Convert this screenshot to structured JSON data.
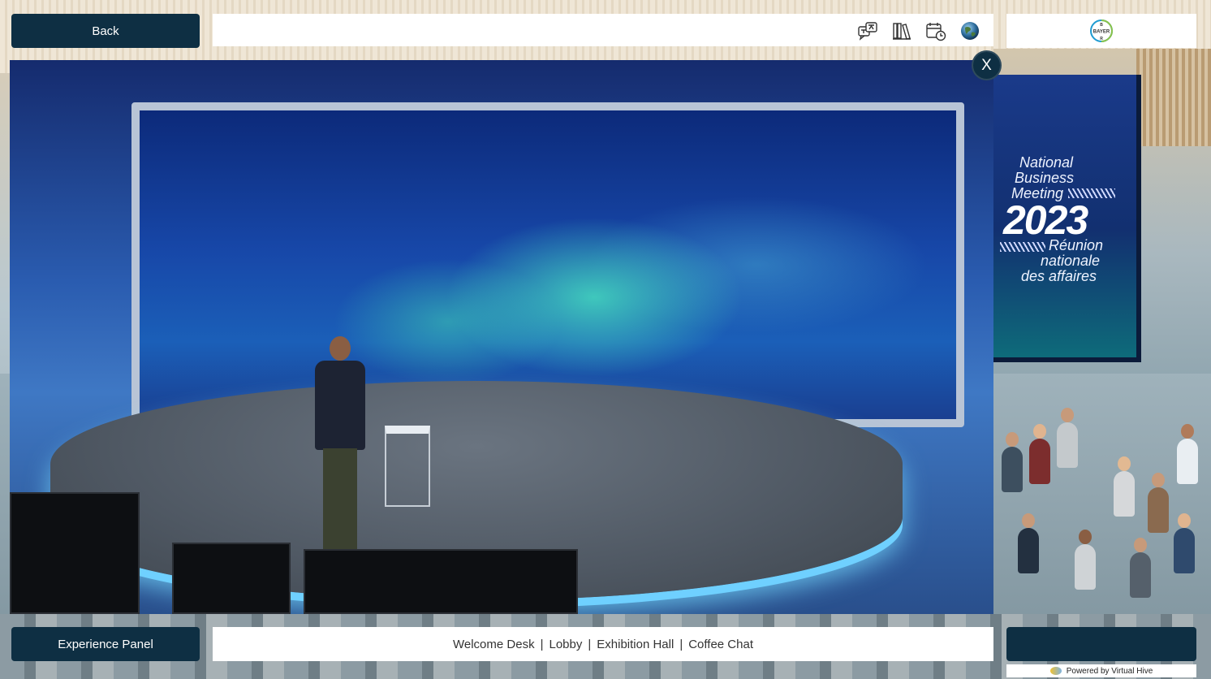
{
  "top": {
    "back_label": "Back",
    "toolbar_icons": [
      "translate-chat-icon",
      "library-icon",
      "calendar-clock-icon",
      "globe-icon"
    ],
    "logo_name": "bayer-logo",
    "logo_text": "BAYER"
  },
  "video": {
    "close_label": "X",
    "banner": {
      "line1": "National",
      "line2": "Business",
      "line3": "Meeting",
      "year": "2023",
      "line4": "Réunion",
      "line5": "nationale",
      "line6": "des affaires"
    }
  },
  "bottom": {
    "experience_label": "Experience Panel",
    "nav": [
      {
        "label": "Welcome Desk"
      },
      {
        "label": "Lobby"
      },
      {
        "label": "Exhibition Hall"
      },
      {
        "label": "Coffee Chat"
      }
    ],
    "separator": "|",
    "powered_by": "Powered by Virtual Hive"
  },
  "colors": {
    "button_bg": "#0e2f43",
    "toolbar_bg": "#ffffff",
    "bayer_blue": "#1f9bd1",
    "bayer_green": "#8bc34a"
  }
}
